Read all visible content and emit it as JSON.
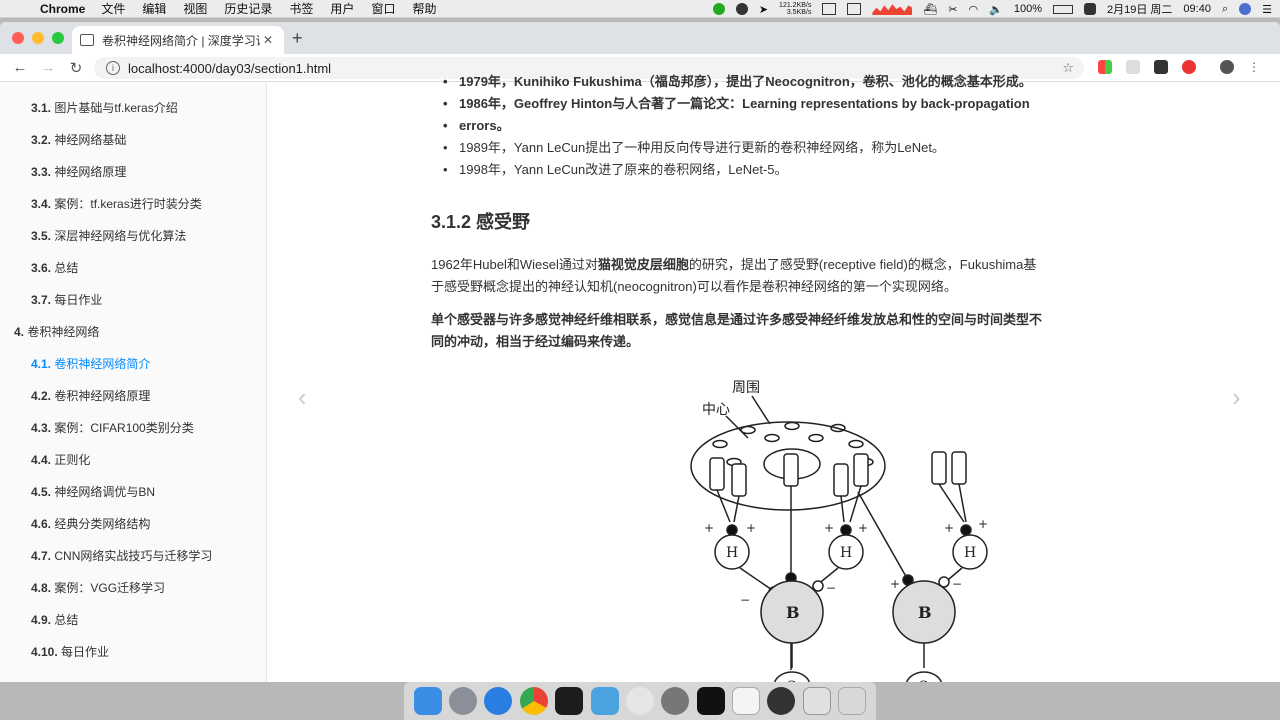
{
  "menubar": {
    "apple": "",
    "app": "Chrome",
    "items": [
      "文件",
      "编辑",
      "视图",
      "历史记录",
      "书签",
      "用户",
      "窗口",
      "帮助"
    ],
    "net_up": "121.2KB/s",
    "net_down": "3.5KB/s",
    "battery": "100%",
    "date": "2月19日 周二",
    "time": "09:40"
  },
  "browser": {
    "tab_title": "卷积神经网络简介 | 深度学习课",
    "url": "localhost:4000/day03/section1.html"
  },
  "sidebar": {
    "items": [
      {
        "num": "3.1.",
        "label": "图片基础与tf.keras介绍"
      },
      {
        "num": "3.2.",
        "label": "神经网络基础"
      },
      {
        "num": "3.3.",
        "label": "神经网络原理"
      },
      {
        "num": "3.4.",
        "label": "案例：tf.keras进行时装分类"
      },
      {
        "num": "3.5.",
        "label": "深层神经网络与优化算法"
      },
      {
        "num": "3.6.",
        "label": "总结"
      },
      {
        "num": "3.7.",
        "label": "每日作业"
      },
      {
        "num": "4.",
        "label": "卷积神经网络"
      },
      {
        "num": "4.1.",
        "label": "卷积神经网络简介"
      },
      {
        "num": "4.2.",
        "label": "卷积神经网络原理"
      },
      {
        "num": "4.3.",
        "label": "案例：CIFAR100类别分类"
      },
      {
        "num": "4.4.",
        "label": "正则化"
      },
      {
        "num": "4.5.",
        "label": "神经网络调优与BN"
      },
      {
        "num": "4.6.",
        "label": "经典分类网络结构"
      },
      {
        "num": "4.7.",
        "label": "CNN网络实战技巧与迁移学习"
      },
      {
        "num": "4.8.",
        "label": "案例：VGG迁移学习"
      },
      {
        "num": "4.9.",
        "label": "总结"
      },
      {
        "num": "4.10.",
        "label": "每日作业"
      }
    ]
  },
  "content": {
    "bullet_top": "1979年，Kunihiko Fukushima（福岛邦彦），提出了Neocognitron，卷积、池化的概念基本形成。",
    "bullet_hinton_a": "1986年，Geoffrey Hinton与人合著了一篇论文：Learning representations by back-propagation",
    "bullet_hinton_b": "errors。",
    "bullet_1989": "1989年，Yann LeCun提出了一种用反向传导进行更新的卷积神经网络，称为LeNet。",
    "bullet_1998": "1998年，Yann LeCun改进了原来的卷积网络，LeNet-5。",
    "heading": "3.1.2 感受野",
    "para1_a": "1962年Hubel和Wiesel通过对",
    "para1_bold": "猫视觉皮层细胞",
    "para1_b": "的研究，提出了感受野(receptive field)的概念，Fukushima基",
    "para1_line2": "于感受野概念提出的神经认知机(neocognitron)可以看作是卷积神经网络的第一个实现网络。",
    "para2_line1": "单个感受器与许多感觉神经纤维相联系，感觉信息是通过许多感受神经纤维发放总和性的空间与时间类型不",
    "para2_line2": "同的冲动，相当于经过编码来传递。",
    "figure": {
      "label_surround": "周围",
      "label_center": "中心",
      "node_h": "H",
      "node_b": "B",
      "node_c": "C"
    }
  }
}
